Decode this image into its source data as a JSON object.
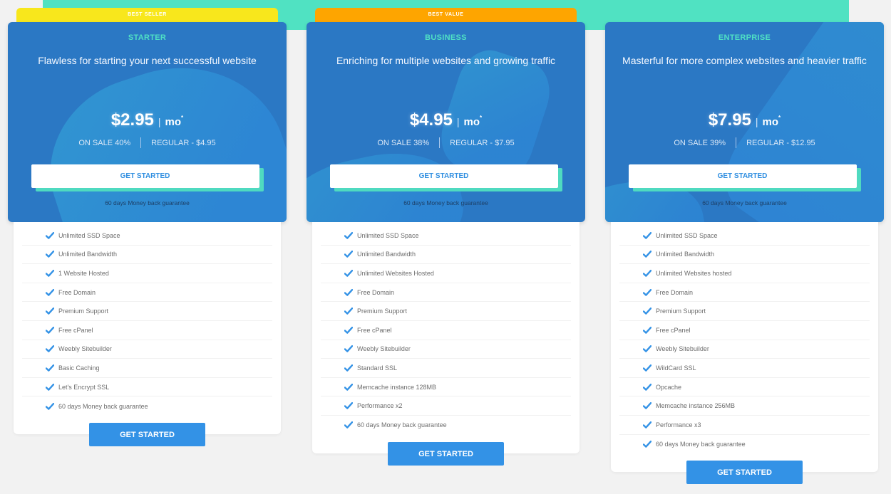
{
  "colors": {
    "teal_band": "#50e2c2",
    "card_blue": "#2b78c4",
    "plan_name": "#4fe0c4",
    "cta_text": "#2f8ee0",
    "bottom_cta": "#3392e6",
    "check": "#3392e6"
  },
  "plans": [
    {
      "ribbon": "BEST SELLER",
      "ribbon_color": "#f8e71c",
      "name": "STARTER",
      "tagline": "Flawless for starting your next successful website",
      "price": "$2.95",
      "price_sep": "|",
      "per": "mo",
      "per_mark": "*",
      "sale": "ON SALE 40%",
      "regular": "REGULAR - $4.95",
      "cta": "GET STARTED",
      "guarantee": "60 days Money back guarantee",
      "features": [
        "Unlimited SSD Space",
        "Unlimited Bandwidth",
        "1 Website Hosted",
        "Free Domain",
        "Premium Support",
        "Free cPanel",
        "Weebly Sitebuilder",
        "Basic Caching",
        "Let's Encrypt SSL",
        "60 days Money back guarantee"
      ],
      "bottom_cta": "GET STARTED"
    },
    {
      "ribbon": "BEST VALUE",
      "ribbon_color": "#fea500",
      "name": "BUSINESS",
      "tagline": "Enriching for multiple websites and growing traffic",
      "price": "$4.95",
      "price_sep": "|",
      "per": "mo",
      "per_mark": "*",
      "sale": "ON SALE 38%",
      "regular": "REGULAR - $7.95",
      "cta": "GET STARTED",
      "guarantee": "60 days Money back guarantee",
      "features": [
        "Unlimited SSD Space",
        "Unlimited Bandwidth",
        "Unlimited Websites Hosted",
        "Free Domain",
        "Premium Support",
        "Free cPanel",
        "Weebly Sitebuilder",
        "Standard SSL",
        "Memcache instance 128MB",
        "Performance x2",
        "60 days Money back guarantee"
      ],
      "bottom_cta": "GET STARTED"
    },
    {
      "ribbon": "",
      "ribbon_color": "",
      "name": "ENTERPRISE",
      "tagline": "Masterful for more complex websites and heavier traffic",
      "price": "$7.95",
      "price_sep": "|",
      "per": "mo",
      "per_mark": "*",
      "sale": "ON SALE 39%",
      "regular": "REGULAR - $12.95",
      "cta": "GET STARTED",
      "guarantee": "60 days Money back guarantee",
      "features": [
        "Unlimited SSD Space",
        "Unlimited Bandwidth",
        "Unlimited Websites hosted",
        "Free Domain",
        "Premium Support",
        "Free cPanel",
        "Weebly Sitebuilder",
        "WildCard SSL",
        "Opcache",
        "Memcache instance 256MB",
        "Performance x3",
        "60 days Money back guarantee"
      ],
      "bottom_cta": "GET STARTED"
    }
  ]
}
